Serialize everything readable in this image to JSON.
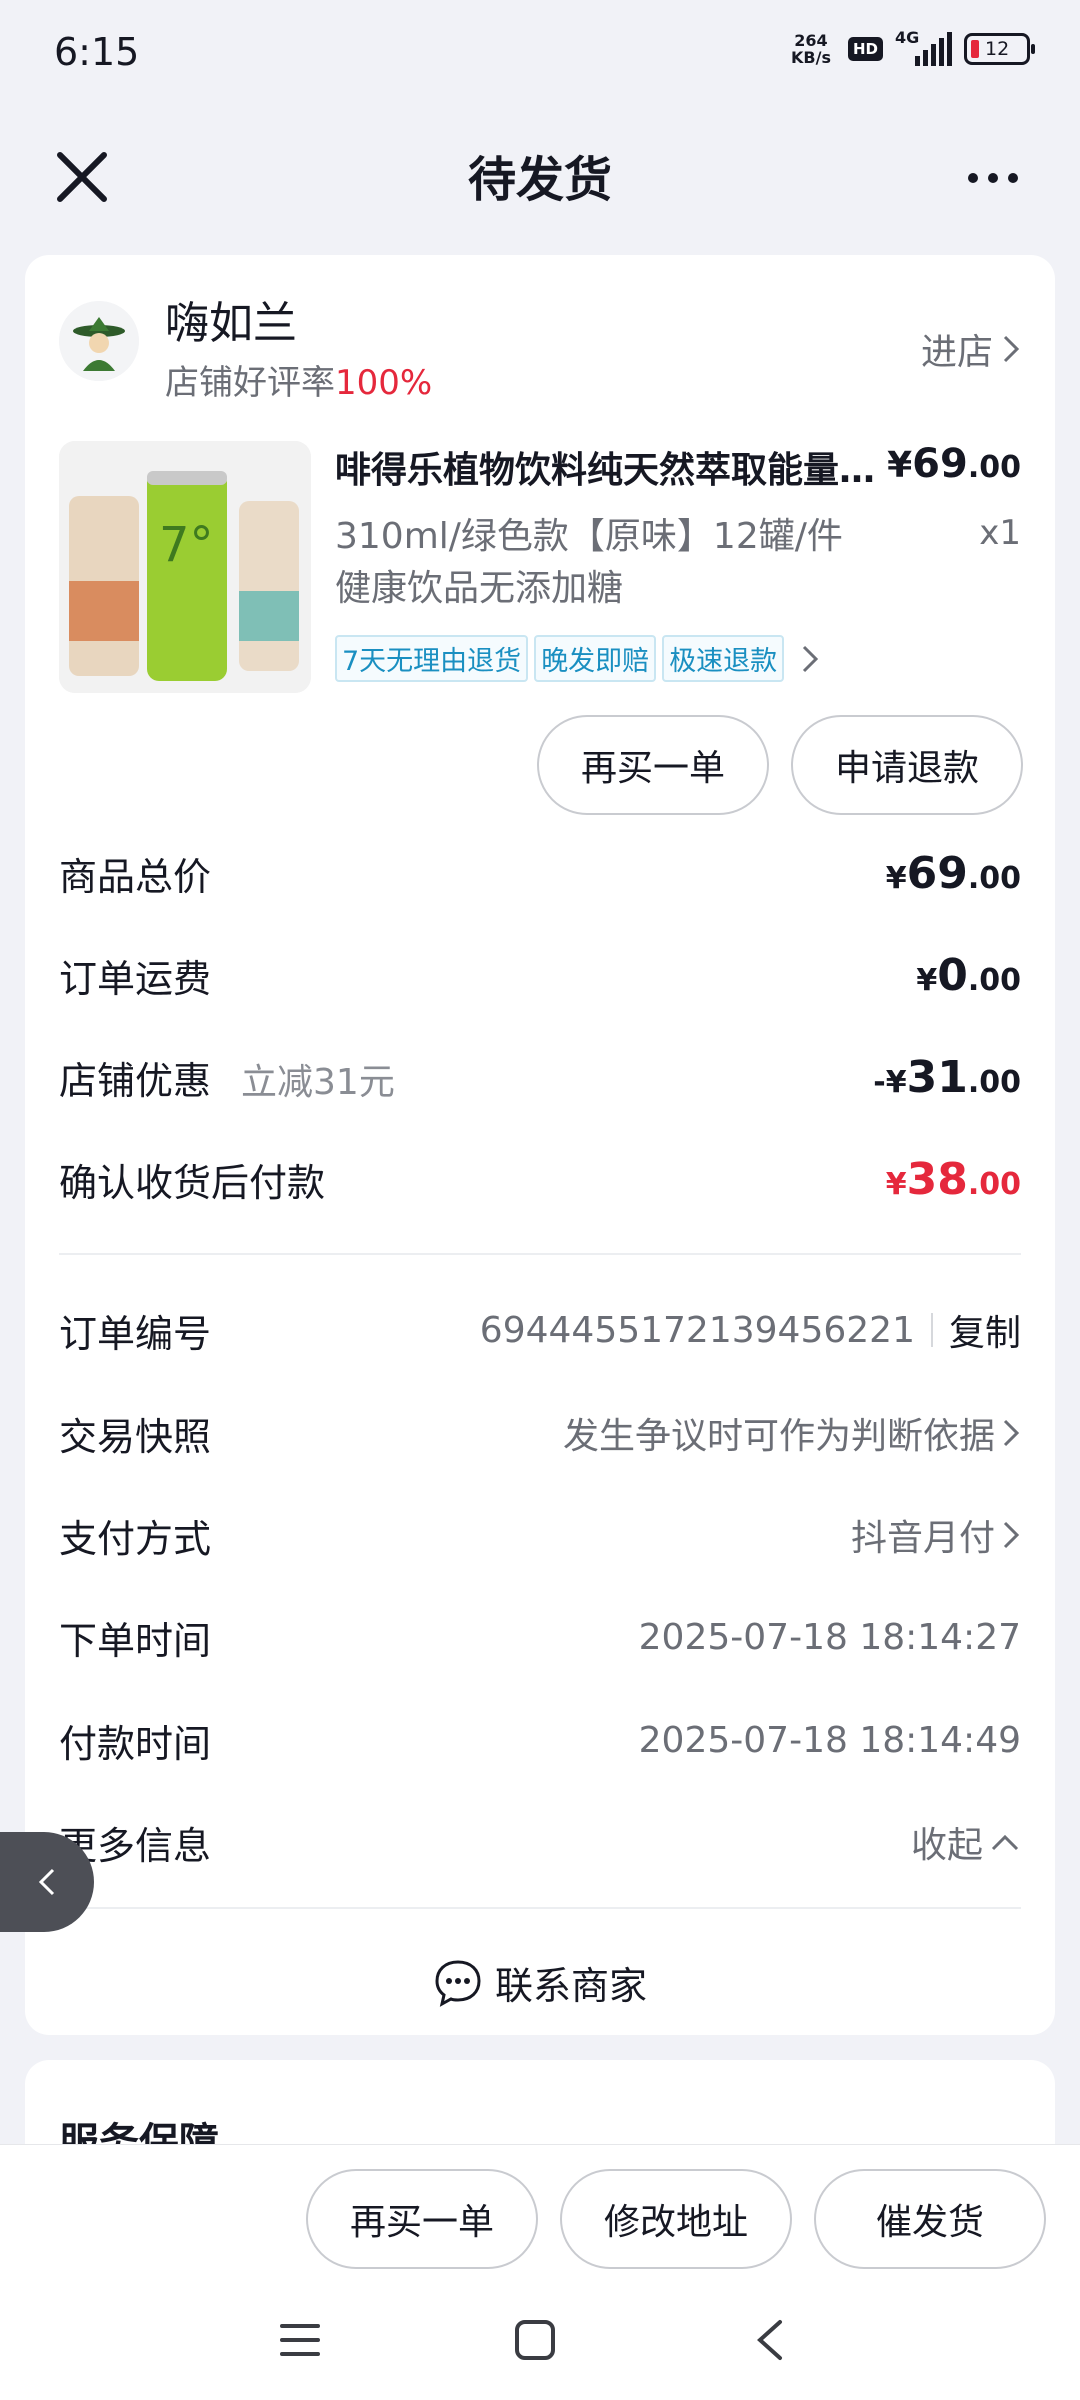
{
  "status_bar": {
    "time": "6:15",
    "net_speed_value": "264",
    "net_speed_unit": "KB/s",
    "hd": "HD",
    "network": "4G",
    "battery": "12"
  },
  "header": {
    "title": "待发货"
  },
  "shop": {
    "name": "嗨如兰",
    "rating_label": "店铺好评率",
    "rating_value": "100%",
    "enter_label": "进店"
  },
  "product": {
    "title": "啡得乐植物饮料纯天然萃取能量饮料",
    "price_symbol": "¥",
    "price_int": "69",
    "price_dec": ".00",
    "spec": "310ml/绿色款【原味】12罐/件 健康饮品无添加糖",
    "quantity": "x1",
    "tags": [
      "7天无理由退货",
      "晚发即赔",
      "极速退款"
    ]
  },
  "actions": {
    "rebuy": "再买一单",
    "refund": "申请退款"
  },
  "summary": {
    "total_label": "商品总价",
    "total_int": "69",
    "total_dec": ".00",
    "shipping_label": "订单运费",
    "shipping_int": "0",
    "shipping_dec": ".00",
    "discount_label": "店铺优惠",
    "discount_note": "立减31元",
    "discount_prefix": "-¥",
    "discount_int": "31",
    "discount_dec": ".00",
    "pay_label": "确认收货后付款",
    "pay_int": "38",
    "pay_dec": ".00",
    "currency": "¥"
  },
  "details": {
    "order_no_label": "订单编号",
    "order_no": "6944455172139456221",
    "copy": "复制",
    "snapshot_label": "交易快照",
    "snapshot_value": "发生争议时可作为判断依据",
    "payment_label": "支付方式",
    "payment_value": "抖音月付",
    "order_time_label": "下单时间",
    "order_time": "2025-07-18 18:14:27",
    "pay_time_label": "付款时间",
    "pay_time": "2025-07-18 18:14:49",
    "more_label": "更多信息",
    "collapse": "收起"
  },
  "contact": {
    "label": "联系商家"
  },
  "service": {
    "title": "服务保障"
  },
  "bottom_bar": {
    "rebuy": "再买一单",
    "change_address": "修改地址",
    "urge": "催发货"
  },
  "colors": {
    "accent_red": "#e5283c",
    "tag_blue": "#1a8fc1",
    "background": "#f1f2f7"
  }
}
